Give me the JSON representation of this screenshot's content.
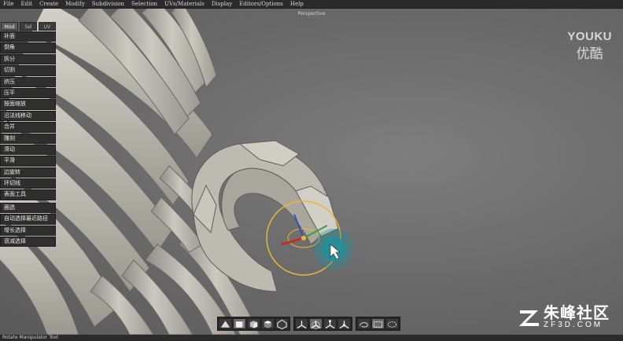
{
  "menu": [
    "File",
    "Edit",
    "Create",
    "Modify",
    "Subdivision",
    "Selection",
    "UVs/Materials",
    "Display",
    "Editors/Options",
    "Help"
  ],
  "viewport": {
    "label": "Perspective"
  },
  "panel": {
    "tabs": [
      {
        "label": "Mod",
        "active": true
      },
      {
        "label": "Sel",
        "active": false
      },
      {
        "label": "UV",
        "active": false
      }
    ],
    "tools": [
      "补面",
      "倒角",
      "拆分",
      "切割",
      "挤压",
      "压平",
      "按面缩放",
      "沿法线移动",
      "合并",
      "雕刻",
      "滑动",
      "平滑",
      "边旋转",
      "环切线",
      "表面工具"
    ],
    "select_tools": [
      "圈选",
      "自动选择最近路径",
      "增长选择",
      "衰减选择"
    ]
  },
  "toolbar": {
    "groups": [
      [
        {
          "icon": "pyramid-view-icon",
          "on": false
        },
        {
          "icon": "cube-front-view-icon",
          "on": true
        },
        {
          "icon": "cube-side-view-icon",
          "on": false
        },
        {
          "icon": "cube-top-view-icon",
          "on": false
        },
        {
          "icon": "sphere-view-icon",
          "on": false
        }
      ],
      [
        {
          "icon": "move-manipulator-icon",
          "on": false
        },
        {
          "icon": "rotate-manipulator-icon",
          "on": true
        },
        {
          "icon": "scale-manipulator-icon",
          "on": false
        },
        {
          "icon": "universal-manipulator-icon",
          "on": false
        }
      ],
      [
        {
          "icon": "lasso-select-icon",
          "on": false
        },
        {
          "icon": "rect-select-icon",
          "on": true
        },
        {
          "icon": "paint-select-icon",
          "on": false
        }
      ]
    ]
  },
  "status": {
    "text": "Rotate Manipulator Tool"
  },
  "watermarks": {
    "youku": "YOUKU",
    "youku_cn": "优酷",
    "site_name": "朱峰社区",
    "site_domain": "ZF3D.COM"
  },
  "colors": {
    "manipulator_ring": "#e8b83a",
    "axis_x": "#c0302a",
    "axis_y": "#3aa040",
    "axis_z": "#3050c0",
    "brush": "#1f8f9a"
  }
}
